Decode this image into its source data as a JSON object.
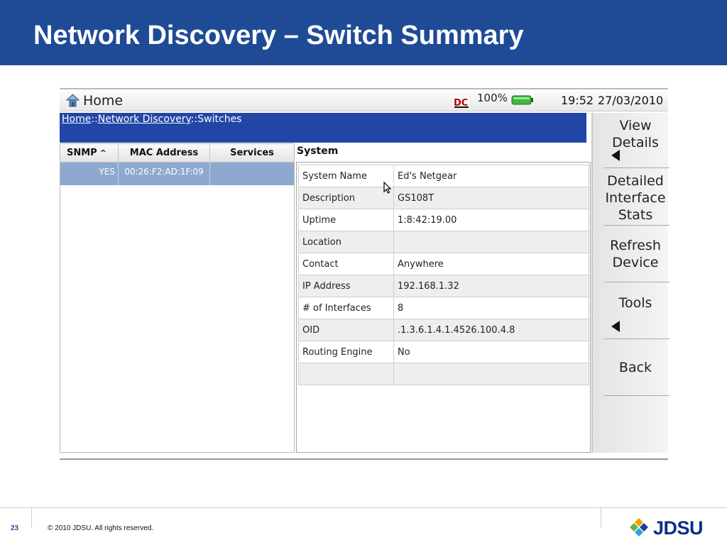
{
  "slide": {
    "title": "Network Discovery – Switch Summary",
    "page_number": "23",
    "copyright": "© 2010 JDSU. All rights reserved.",
    "logo_text": "JDSU"
  },
  "device": {
    "window_title": "Home",
    "battery": "100%",
    "time": "19:52",
    "date": "27/03/2010",
    "breadcrumb": {
      "home": "Home",
      "sep1": "::",
      "network_discovery": "Network Discovery",
      "sep2": "::",
      "current": "Switches"
    }
  },
  "device_list": {
    "columns": [
      "SNMP",
      "MAC Address",
      "Services"
    ],
    "sort_indicator": "^",
    "rows": [
      {
        "snmp": "YES",
        "mac": "00:26:F2:AD:1F:09",
        "services": ""
      }
    ]
  },
  "system": {
    "title": "System",
    "rows": [
      {
        "label": "System Name",
        "value": "Ed's Netgear"
      },
      {
        "label": "Description",
        "value": "GS108T"
      },
      {
        "label": "Uptime",
        "value": "1:8:42:19.00"
      },
      {
        "label": "Location",
        "value": ""
      },
      {
        "label": "Contact",
        "value": "Anywhere"
      },
      {
        "label": "IP Address",
        "value": "192.168.1.32"
      },
      {
        "label": "# of Interfaces",
        "value": "8"
      },
      {
        "label": "OID",
        "value": ".1.3.6.1.4.1.4526.100.4.8"
      },
      {
        "label": "Routing Engine",
        "value": "No"
      },
      {
        "label": "",
        "value": ""
      }
    ]
  },
  "softkeys": {
    "view_details": [
      "View",
      "Details"
    ],
    "detailed_interface_stats": [
      "Detailed",
      "Interface",
      "Stats"
    ],
    "refresh_device": [
      "Refresh",
      "Device"
    ],
    "tools": [
      "Tools"
    ],
    "back": [
      "Back"
    ]
  },
  "colors": {
    "header_blue": "#1f4b96",
    "breadcrumb_blue": "#2146a6",
    "selected_row": "#8da9cf",
    "logo_blue": "#0a2f87"
  },
  "icons": {
    "home": "home-icon",
    "dc_power": "dc-power-icon",
    "battery": "battery-icon",
    "cursor": "cursor-icon",
    "logo": "jdsu-logo-icon"
  }
}
